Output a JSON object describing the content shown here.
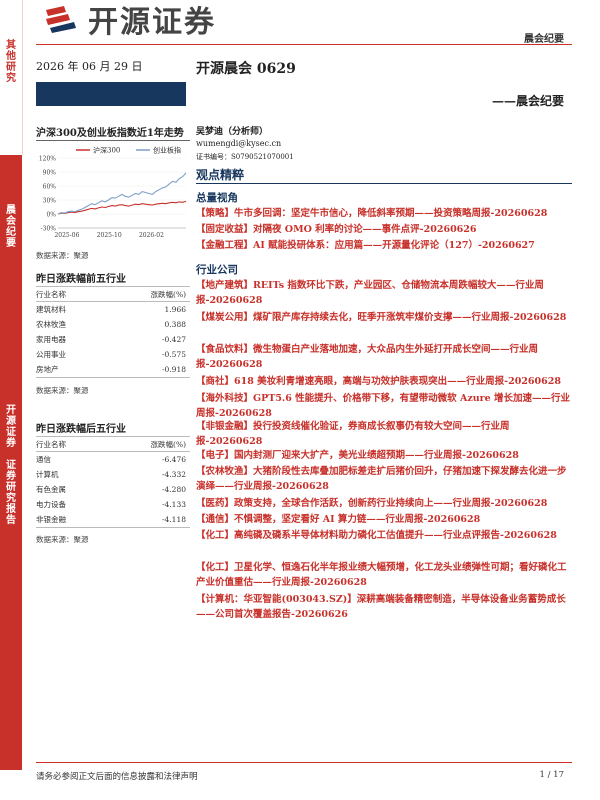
{
  "brand": {
    "logo_text": "开源证券"
  },
  "header": {
    "category_right": "晨会纪要",
    "date": "2026 年 06 月 29 日",
    "title": "开源晨会 0629",
    "subtitle": "——晨会纪要"
  },
  "left_strip": {
    "top_label": [
      "其",
      "他",
      "研",
      "究"
    ],
    "mid_label": [
      "晨",
      "会",
      "纪",
      "要"
    ],
    "bottom_label": [
      "开",
      "源",
      "证",
      "券",
      " ",
      "证",
      "券",
      "研",
      "究",
      "报",
      "告"
    ]
  },
  "chart_section": {
    "title": "沪深300及创业板指数近1年走势",
    "source": "数据来源：聚源"
  },
  "chart_data": {
    "type": "line",
    "x_ticks": [
      "2025-06",
      "2025-10",
      "2026-02"
    ],
    "y_ticks": [
      "120%",
      "90%",
      "60%",
      "30%",
      "0%",
      "-30%"
    ],
    "ylim": [
      -30,
      120
    ],
    "series": [
      {
        "name": "沪深300",
        "color": "#c8302a",
        "values": [
          0,
          2,
          1,
          3,
          4,
          3,
          5,
          6,
          8,
          10,
          12,
          11,
          13,
          15,
          14,
          16,
          18,
          17,
          19,
          20,
          18,
          17,
          19,
          21,
          20,
          22,
          21,
          20,
          19,
          21,
          22,
          23,
          22,
          24,
          25,
          24,
          26,
          25,
          27
        ]
      },
      {
        "name": "创业板指",
        "color": "#7f9fc9",
        "values": [
          0,
          3,
          2,
          5,
          6,
          5,
          8,
          10,
          14,
          18,
          22,
          20,
          24,
          28,
          26,
          30,
          35,
          34,
          38,
          42,
          38,
          36,
          40,
          44,
          42,
          48,
          46,
          44,
          42,
          48,
          52,
          56,
          58,
          64,
          70,
          68,
          76,
          80,
          88
        ]
      }
    ]
  },
  "top_gainers": {
    "title": "昨日涨跌幅前五行业",
    "headers": [
      "行业名称",
      "涨跌幅(%)"
    ],
    "rows": [
      [
        "建筑材料",
        "1.966"
      ],
      [
        "农林牧渔",
        "0.388"
      ],
      [
        "家用电器",
        "-0.427"
      ],
      [
        "公用事业",
        "-0.575"
      ],
      [
        "房地产",
        "-0.918"
      ]
    ],
    "source": "数据来源：聚源"
  },
  "top_losers": {
    "title": "昨日涨跌幅后五行业",
    "headers": [
      "行业名称",
      "涨跌幅(%)"
    ],
    "rows": [
      [
        "通信",
        "-6.476"
      ],
      [
        "计算机",
        "-4.332"
      ],
      [
        "有色金属",
        "-4.280"
      ],
      [
        "电力设备",
        "-4.133"
      ],
      [
        "非银金融",
        "-4.118"
      ]
    ],
    "source": "数据来源：聚源"
  },
  "author": {
    "name": "吴梦迪（分析师）",
    "email": "wumengdi@kysec.cn",
    "cert": "证书编号：S0790521070001"
  },
  "main": {
    "section_title": "观点精粹",
    "macro_title": "总量视角",
    "macro_items": [
      "【策略】牛市多回调：坚定牛市信心，降低斜率预期——投资策略周报-20260628",
      "【固定收益】对隔夜 OMO 利率的讨论——事件点评-20260626",
      "【金融工程】AI 赋能投研体系：应用篇——开源量化评论（127）-20260627"
    ],
    "industry_title": "行业公司",
    "industry_items": [
      "【地产建筑】REITs 指数环比下跌，产业园区、仓储物流本周跌幅较大——行业周报-20260628",
      "【煤炭公用】煤矿限产库存持续去化，旺季开涨筑牢煤价支撑——行业周报-20260628",
      "【食品饮料】微生物蛋白产业落地加速，大众品内生外延打开成长空间——行业周报-20260628",
      "【商社】618 美妆利青增速亮眼，高端与功效护肤表现突出——行业周报-20260628",
      "【海外科技】GPT5.6 性能提升、价格带下移，有望带动微软 Azure 增长加速——行业周报-20260628",
      "【非银金融】投行投资线催化验证，券商成长叙事仍有较大空间——行业周报-20260628",
      "【电子】国内封测厂迎来大扩产，美光业绩超预期——行业周报-20260628",
      "【农林牧渔】大猪阶段性去库叠加肥标差走扩后猪价回升，仔猪加速下探发酵去化进一步演绎——行业周报-20260628",
      "【医药】政策支持，全球合作活跃，创新药行业持续向上——行业周报-20260628",
      "【通信】不惧调整，坚定看好 AI 算力链——行业周报-20260628",
      "【化工】高纯磷及磷系半导体材料助力磷化工估值提升——行业点评报告-20260628",
      "【化工】卫星化学、恒逸石化半年报业绩大幅预增，化工龙头业绩弹性可期；看好磷化工产业价值重估——行业周报-20260628",
      "【计算机：华亚智能(003043.SZ)】深耕高端装备精密制造，半导体设备业务蓄势成长——公司首次覆盖报告-20260626"
    ]
  },
  "footer": {
    "disclaimer": "请务必参阅正文后面的信息披露和法律声明",
    "page": "1 / 17"
  }
}
